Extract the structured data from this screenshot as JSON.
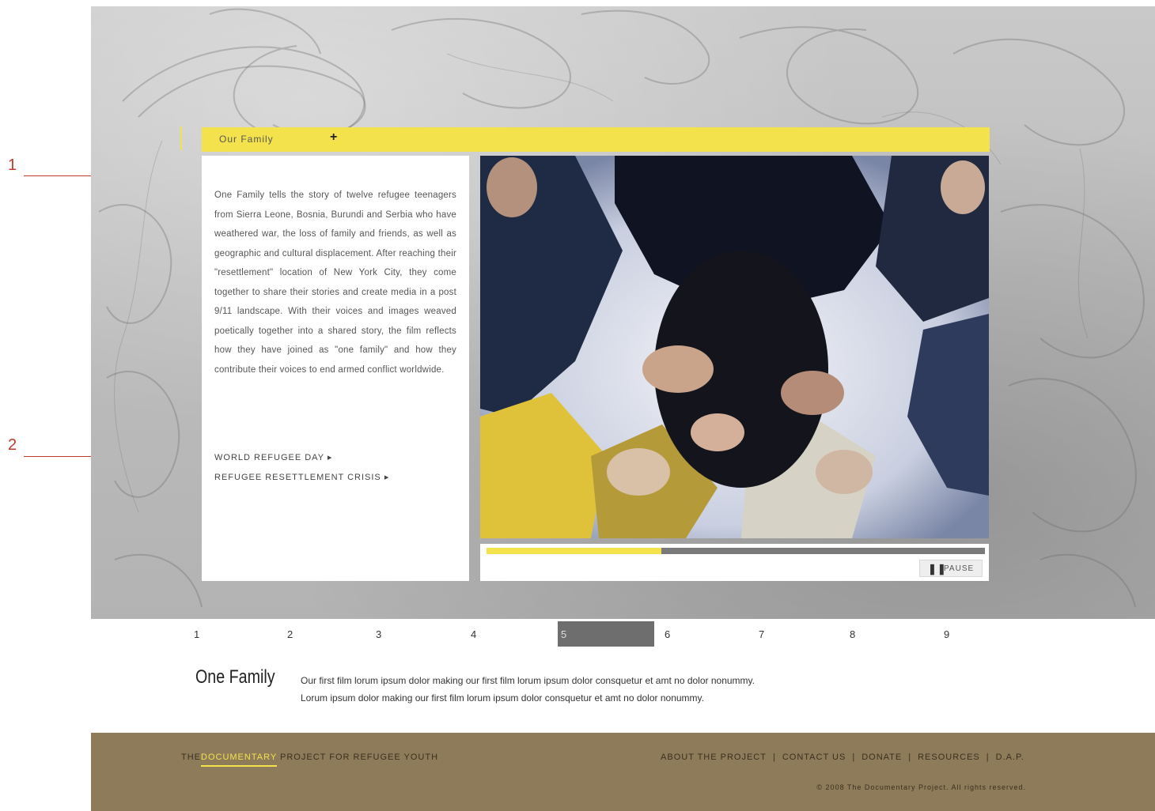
{
  "callouts": [
    "1",
    "2"
  ],
  "titlebar": {
    "crumb": "Our Family",
    "plus": "+"
  },
  "textpanel": {
    "description": "One Family tells the story of twelve refugee teenagers from Sierra Leone, Bosnia, Burundi and Serbia who have weathered war, the loss of family and friends, as well as geographic and cultural displacement. After reaching their \"resettlement\" location of New York City, they come together to share their stories and create media in a post 9/11 landscape. With their voices and images weaved poetically together into a shared story, the film reflects how they have joined as \"one family\" and how they contribute their voices to end armed conflict worldwide.",
    "links": [
      "WORLD REFUGEE DAY  ▸",
      "REFUGEE RESETTLEMENT CRISIS  ▸"
    ]
  },
  "player": {
    "progress": 0.35,
    "pause_icon": "pause-icon",
    "pause_label": "PAUSE"
  },
  "chapters": {
    "items": [
      "1",
      "2",
      "3",
      "4",
      "5",
      "6",
      "7",
      "8",
      "9"
    ],
    "active_index": 4
  },
  "film": {
    "title": "One Family",
    "blurb_line1": "Our first film lorum ipsum dolor making our first film lorum ipsum dolor consquetur et amt no dolor nonummy.",
    "blurb_line2": "Lorum ipsum dolor making our first film lorum ipsum dolor consquetur et amt no dolor nonummy."
  },
  "footer": {
    "brand_prefix": "THE",
    "brand_highlight": "DOCUMENTARY",
    "brand_suffix": "PROJECT FOR REFUGEE YOUTH",
    "nav": [
      "ABOUT THE PROJECT",
      "CONTACT US",
      "DONATE",
      "RESOURCES",
      "D.A.P."
    ],
    "copyright": "© 2008 The Documentary Project. All rights reserved."
  },
  "colors": {
    "accent": "#f3e24b",
    "footer_bg": "#8e7b59",
    "active_chapter": "#6e6e6e",
    "callout": "#c0392b"
  }
}
